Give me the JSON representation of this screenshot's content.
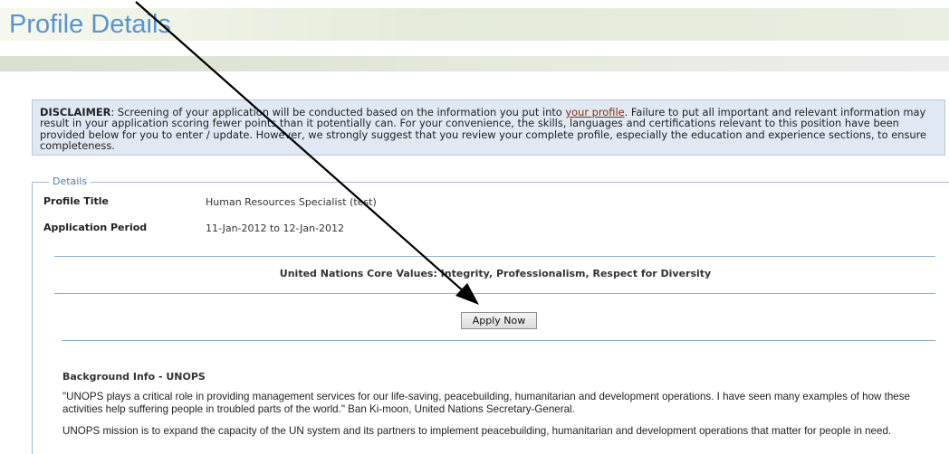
{
  "header": {
    "title": "Profile Details"
  },
  "disclaimer": {
    "label": "DISCLAIMER",
    "text_before_link": ": Screening of your application will be conducted based on the information you put into ",
    "link_text": "your profile",
    "text_after_link": ". Failure to put all important and relevant information may result in your application scoring fewer points than it potentially can. For your convenience, the skills, languages and certifications relevant to this position have been provided below for you to enter / update. However, we strongly suggest that you review your complete profile, especially the education and experience sections, to ensure completeness."
  },
  "details": {
    "legend": "Details",
    "profile_title_label": "Profile Title",
    "profile_title_value": "Human Resources Specialist (test)",
    "application_period_label": "Application Period",
    "application_period_value": "11-Jan-2012 to 12-Jan-2012",
    "core_values": "United Nations Core Values: Integrity, Professionalism, Respect for Diversity",
    "apply_button": "Apply Now"
  },
  "background": {
    "heading": "Background Info - UNOPS",
    "quote": "\"UNOPS plays a critical role in providing management services for our life-saving, peacebuilding, humanitarian and development operations. I have seen many examples of how these activities help suffering people in troubled parts of the world.\" Ban Ki-moon, United Nations Secretary-General.",
    "mission": "UNOPS mission is to expand the capacity of the UN system and its partners to implement peacebuilding, humanitarian and development operations that matter for people in need."
  },
  "colors": {
    "title_blue": "#5a93d2",
    "disclaimer_bg": "#dfe8f3",
    "link_red": "#8b2a15",
    "rule_blue": "#8fb0cf"
  },
  "annotation": {
    "arrow": "pointer-arrow"
  }
}
